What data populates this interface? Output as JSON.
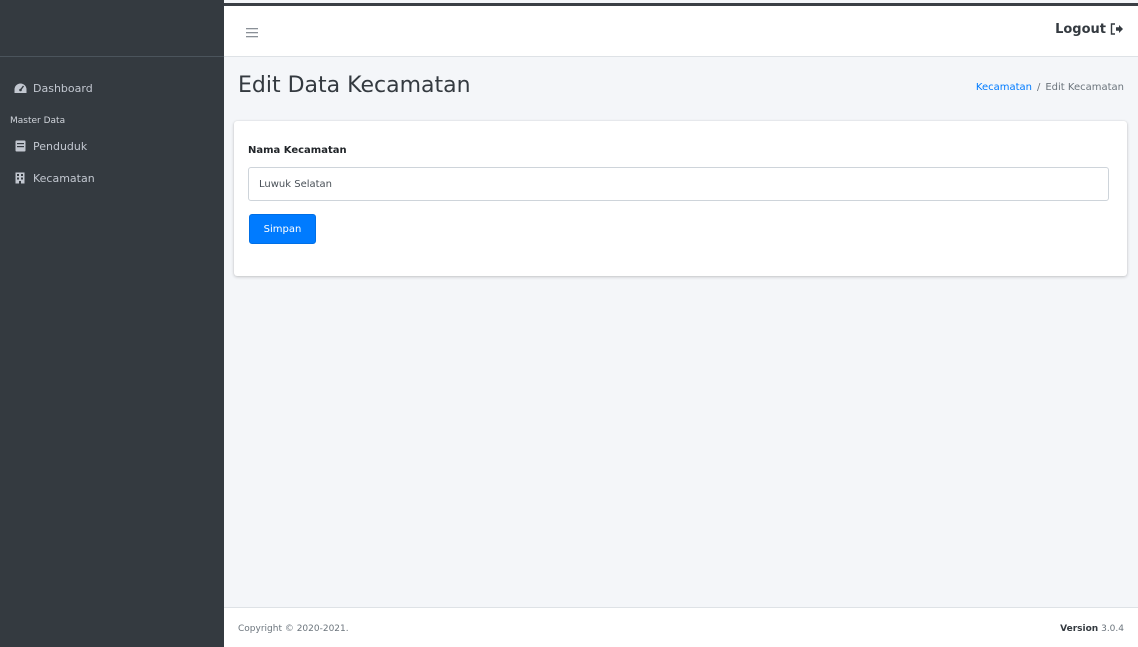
{
  "sidebar": {
    "items": [
      {
        "label": "Dashboard",
        "icon": "dashboard-icon"
      },
      {
        "label": "Penduduk",
        "icon": "book-icon"
      },
      {
        "label": "Kecamatan",
        "icon": "building-icon"
      }
    ],
    "section_header": "Master Data"
  },
  "topbar": {
    "logout_label": "Logout",
    "menu_icon": "hamburger-icon",
    "logout_icon": "sign-out-icon"
  },
  "page": {
    "title": "Edit Data Kecamatan",
    "breadcrumb": {
      "parent": "Kecamatan",
      "separator": "/",
      "current": "Edit Kecamatan"
    }
  },
  "form": {
    "field_label": "Nama Kecamatan",
    "field_value": "Luwuk Selatan",
    "submit_label": "Simpan"
  },
  "footer": {
    "copyright": "Copyright © 2020-2021.",
    "version_label": "Version",
    "version_number": "3.0.4"
  },
  "colors": {
    "sidebar_bg": "#343a40",
    "content_bg": "#f4f6f9",
    "primary": "#007bff"
  }
}
